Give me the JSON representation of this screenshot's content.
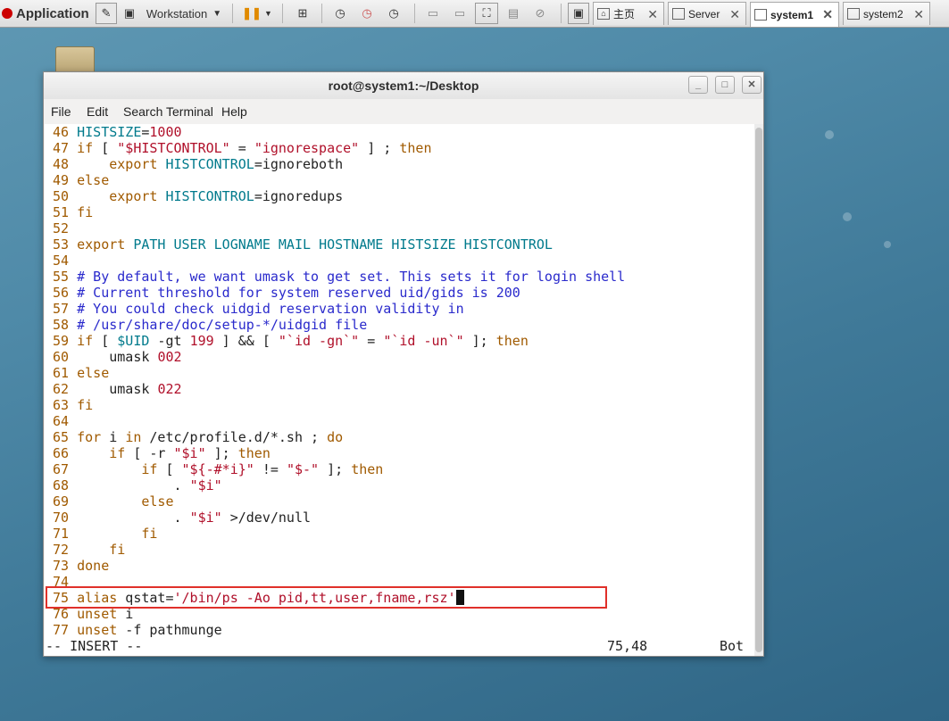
{
  "vmware_toolbar": {
    "app_label": "Application",
    "workstation_label": "Workstation",
    "tabs": [
      {
        "label": "主页"
      },
      {
        "label": "Server"
      },
      {
        "label": "system1"
      },
      {
        "label": "system2"
      }
    ]
  },
  "window": {
    "title": "root@system1:~/Desktop",
    "menu": [
      "File",
      "Edit",
      "Search",
      "Terminal",
      "Help"
    ]
  },
  "editor": {
    "status_mode": "-- INSERT --",
    "status_position": "75,48",
    "status_scroll": "Bot",
    "lines": [
      {
        "n": "46",
        "text": "HISTSIZE=1000"
      },
      {
        "n": "47",
        "text": "if [ \"$HISTCONTROL\" = \"ignorespace\" ] ; then"
      },
      {
        "n": "48",
        "text": "    export HISTCONTROL=ignoreboth"
      },
      {
        "n": "49",
        "text": "else"
      },
      {
        "n": "50",
        "text": "    export HISTCONTROL=ignoredups"
      },
      {
        "n": "51",
        "text": "fi"
      },
      {
        "n": "52",
        "text": ""
      },
      {
        "n": "53",
        "text": "export PATH USER LOGNAME MAIL HOSTNAME HISTSIZE HISTCONTROL"
      },
      {
        "n": "54",
        "text": ""
      },
      {
        "n": "55",
        "text": "# By default, we want umask to get set. This sets it for login shell"
      },
      {
        "n": "56",
        "text": "# Current threshold for system reserved uid/gids is 200"
      },
      {
        "n": "57",
        "text": "# You could check uidgid reservation validity in"
      },
      {
        "n": "58",
        "text": "# /usr/share/doc/setup-*/uidgid file"
      },
      {
        "n": "59",
        "text": "if [ $UID -gt 199 ] && [ \"`id -gn`\" = \"`id -un`\" ]; then"
      },
      {
        "n": "60",
        "text": "    umask 002"
      },
      {
        "n": "61",
        "text": "else"
      },
      {
        "n": "62",
        "text": "    umask 022"
      },
      {
        "n": "63",
        "text": "fi"
      },
      {
        "n": "64",
        "text": ""
      },
      {
        "n": "65",
        "text": "for i in /etc/profile.d/*.sh ; do"
      },
      {
        "n": "66",
        "text": "    if [ -r \"$i\" ]; then"
      },
      {
        "n": "67",
        "text": "        if [ \"${-#*i}\" != \"$-\" ]; then"
      },
      {
        "n": "68",
        "text": "            . \"$i\""
      },
      {
        "n": "69",
        "text": "        else"
      },
      {
        "n": "70",
        "text": "            . \"$i\" >/dev/null"
      },
      {
        "n": "71",
        "text": "        fi"
      },
      {
        "n": "72",
        "text": "    fi"
      },
      {
        "n": "73",
        "text": "done"
      },
      {
        "n": "74",
        "text": ""
      },
      {
        "n": "75",
        "text": "alias qstat='/bin/ps -Ao pid,tt,user,fname,rsz'"
      },
      {
        "n": "76",
        "text": "unset i"
      },
      {
        "n": "77",
        "text": "unset -f pathmunge"
      }
    ]
  }
}
